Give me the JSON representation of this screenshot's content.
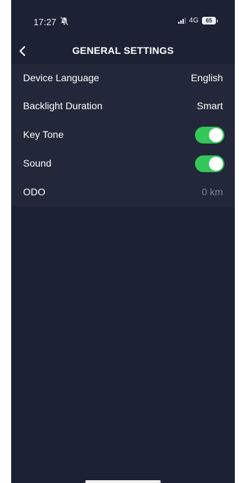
{
  "status_bar": {
    "time": "17:27",
    "network": "4G",
    "battery": "65"
  },
  "header": {
    "title": "GENERAL SETTINGS",
    "back_icon": "chevron-left-icon"
  },
  "settings": [
    {
      "label": "Device Language",
      "value": "English",
      "type": "value"
    },
    {
      "label": "Backlight Duration",
      "value": "Smart",
      "type": "value"
    },
    {
      "label": "Key Tone",
      "type": "toggle",
      "on": true
    },
    {
      "label": "Sound",
      "type": "toggle",
      "on": true
    },
    {
      "label": "ODO",
      "value": "0 km",
      "type": "value"
    }
  ],
  "colors": {
    "background": "#1c2133",
    "panel": "#222839",
    "toggle_on": "#33c759",
    "muted_text": "#7b8190"
  }
}
